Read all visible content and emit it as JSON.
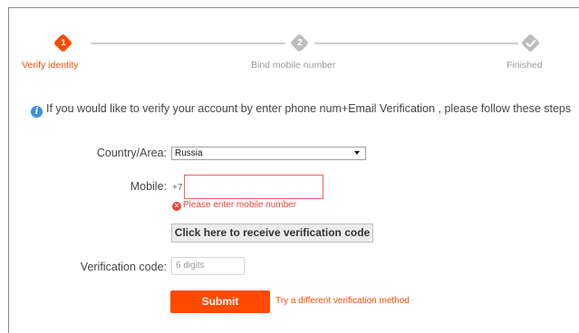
{
  "steps": [
    {
      "number": "1",
      "label": "Verify identity"
    },
    {
      "number": "2",
      "label": "Bind mobile number"
    },
    {
      "label": "Finished"
    }
  ],
  "colors": {
    "accent": "#ff4a00",
    "inactive": "#bdbdbd",
    "error": "#e8453c",
    "info": "#3c8ede"
  },
  "info": {
    "text": "If you would like to verify your account by enter phone num+Email Verification , please follow these steps"
  },
  "form": {
    "country_label": "Country/Area:",
    "country_value": "Russia",
    "mobile_label": "Mobile:",
    "mobile_prefix": "+7",
    "mobile_value": "",
    "mobile_error": "Please enter mobile number",
    "receive_code_button": "Click here to receive verification code",
    "verification_label": "Verification code:",
    "verification_placeholder": "6 digits",
    "submit_button": "Submit",
    "alternate_link": "Try a different verification method"
  },
  "icons": {
    "step_done": "check-icon",
    "info": "info-icon",
    "error": "error-icon",
    "dropdown": "caret-down-icon"
  }
}
